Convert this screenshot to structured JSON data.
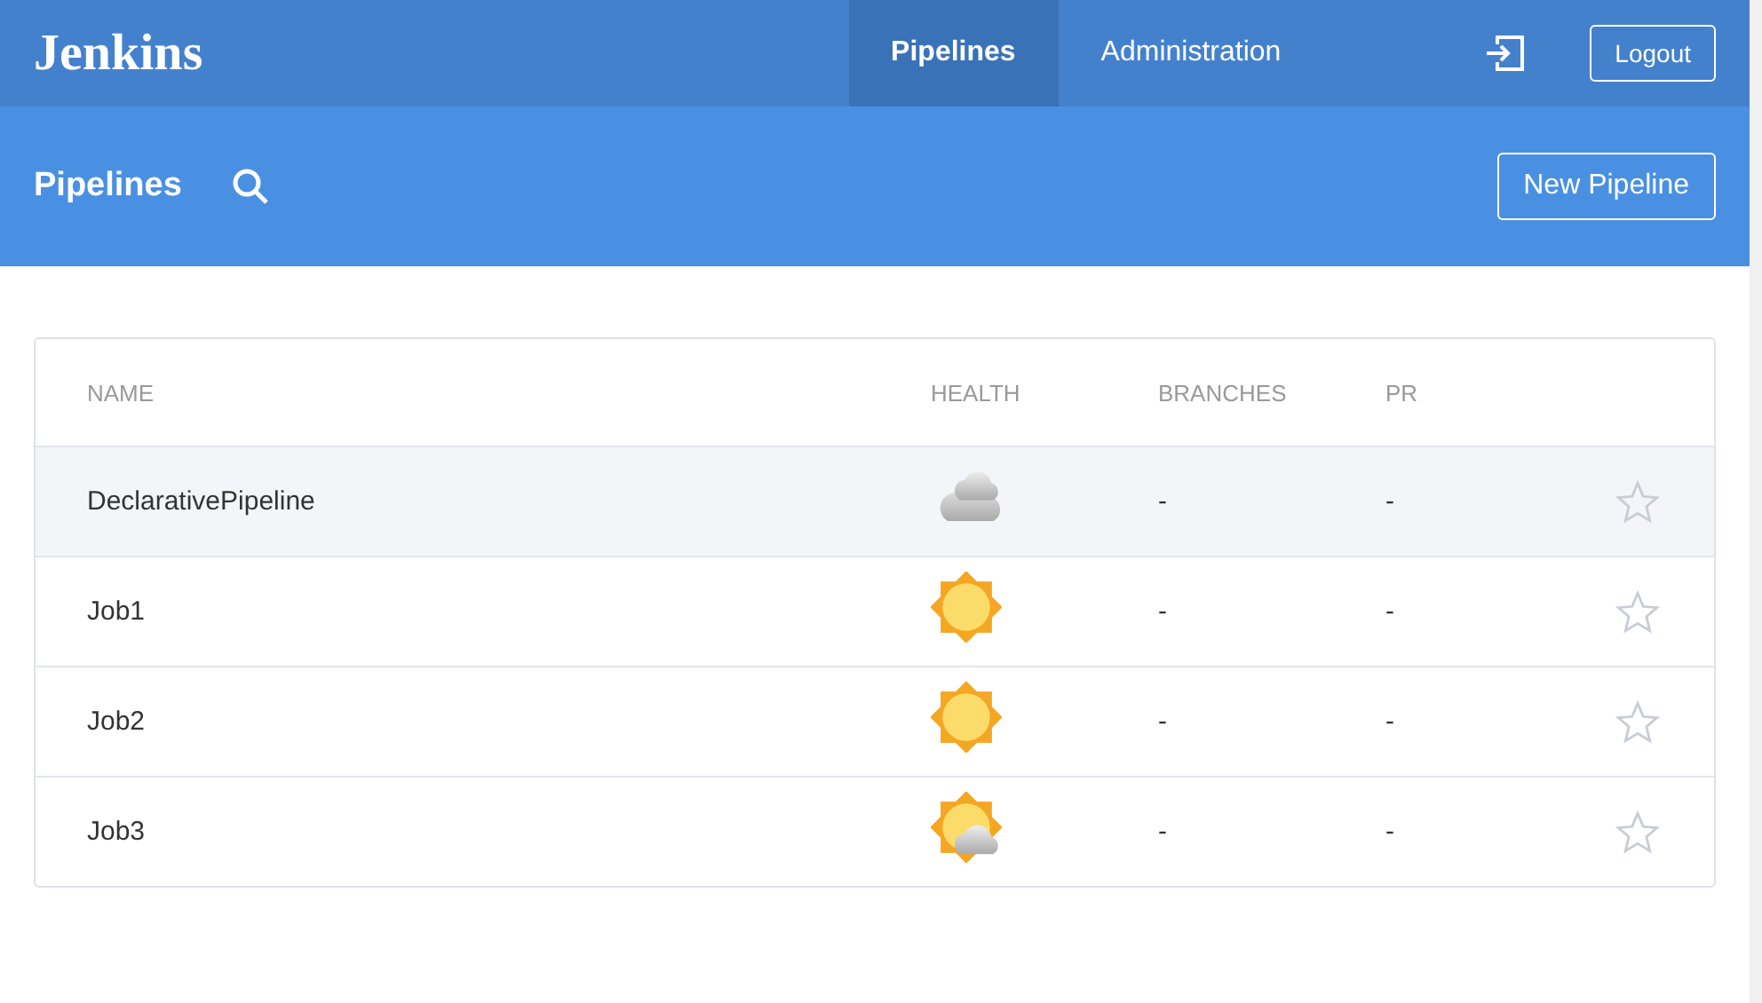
{
  "top_bar": {
    "logo": "Jenkins",
    "nav": [
      {
        "label": "Pipelines",
        "selected": true
      },
      {
        "label": "Administration",
        "selected": false
      }
    ],
    "logout": "Logout"
  },
  "header": {
    "title": "Pipelines",
    "new_button": "New Pipeline"
  },
  "table": {
    "columns": [
      "NAME",
      "HEALTH",
      "BRANCHES",
      "PR"
    ],
    "rows": [
      {
        "name": "DeclarativePipeline",
        "kind": "cloudy",
        "branches": "-",
        "pr": "-",
        "selected": true,
        "favorite": false
      },
      {
        "name": "Job1",
        "kind": "sunny",
        "branches": "-",
        "pr": "-",
        "selected": false,
        "favorite": false
      },
      {
        "name": "Job2",
        "kind": "sunny",
        "branches": "-",
        "pr": "-",
        "selected": false,
        "favorite": false
      },
      {
        "name": "Job3",
        "kind": "partly-sunny",
        "branches": "-",
        "pr": "-",
        "selected": false,
        "favorite": false
      }
    ]
  }
}
